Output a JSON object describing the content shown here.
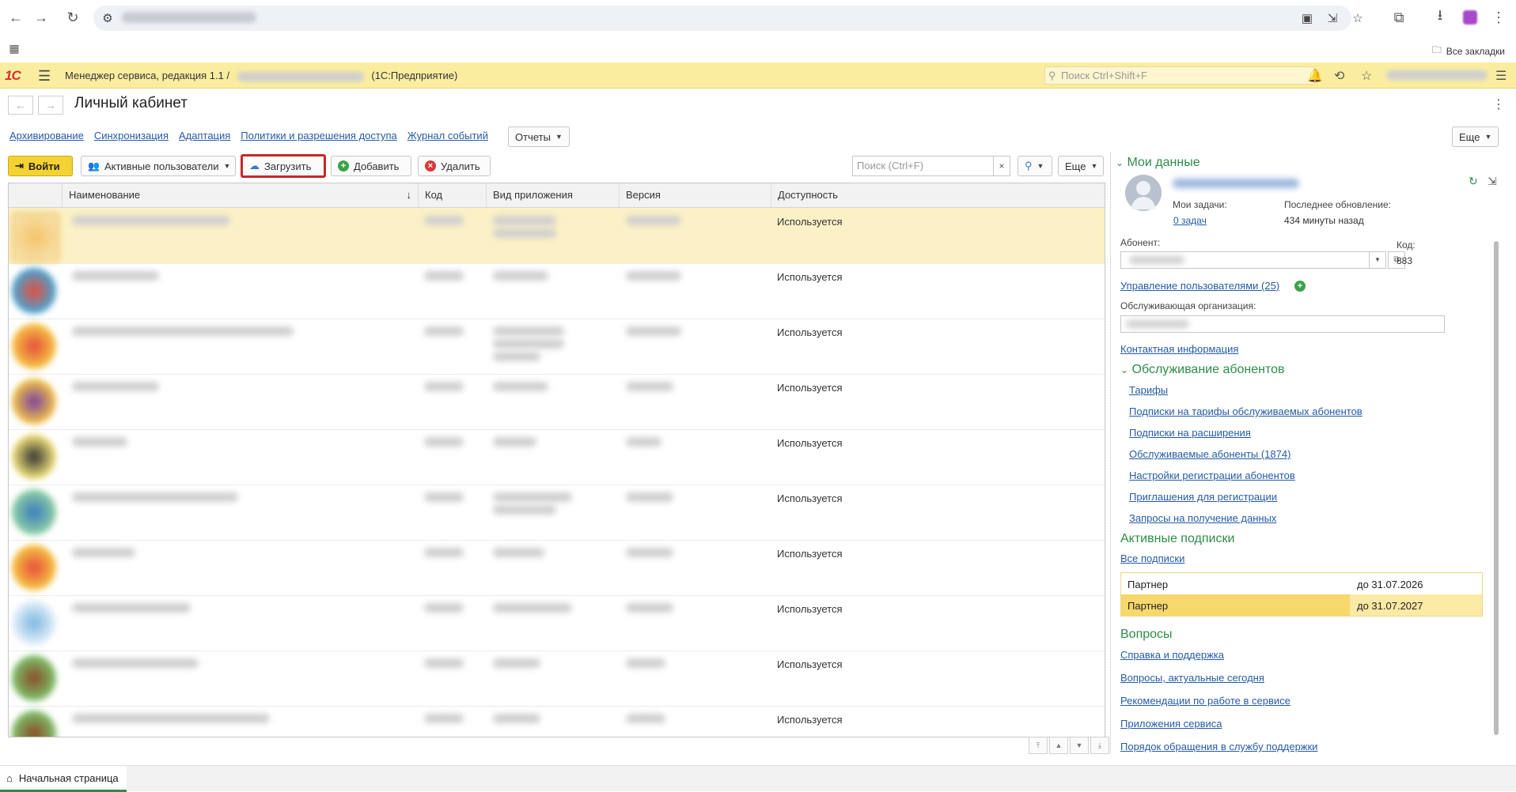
{
  "browser": {
    "bookmarks_all": "Все закладки"
  },
  "app": {
    "title": "Менеджер сервиса, редакция 1.1 /",
    "platform": "(1С:Предприятие)",
    "search_placeholder": "Поиск Ctrl+Shift+F"
  },
  "page": {
    "title": "Личный кабинет"
  },
  "links": [
    "Архивирование",
    "Синхронизация",
    "Адаптация",
    "Политики и разрешения доступа",
    "Журнал событий"
  ],
  "toolbar": {
    "reports": "Отчеты",
    "login": "Войти",
    "active_users": "Активные пользователи",
    "upload": "Загрузить",
    "add": "Добавить",
    "delete": "Удалить",
    "search_placeholder": "Поиск (Ctrl+F)",
    "more": "Еще",
    "more_top": "Еще"
  },
  "table": {
    "columns": [
      "Наименование",
      "Код",
      "Вид приложения",
      "Версия",
      "Доступность"
    ],
    "rows": [
      {
        "availability": "Используется"
      },
      {
        "availability": "Используется"
      },
      {
        "availability": "Используется"
      },
      {
        "availability": "Используется"
      },
      {
        "availability": "Используется"
      },
      {
        "availability": "Используется"
      },
      {
        "availability": "Используется"
      },
      {
        "availability": "Используется"
      },
      {
        "availability": "Используется"
      },
      {
        "availability": "Используется"
      }
    ]
  },
  "right_panel": {
    "my_data_title": "Мои данные",
    "my_tasks_label": "Мои задачи:",
    "my_tasks_link": "0 задач",
    "last_update_label": "Последнее обновление:",
    "last_update_value": "434 минуты назад",
    "subscriber_label": "Абонент:",
    "code_label": "Код:",
    "code_value": "883",
    "manage_users": "Управление пользователями (25)",
    "service_org_label": "Обслуживающая организация:",
    "contact_info": "Контактная информация",
    "service_title": "Обслуживание абонентов",
    "service_links": [
      "Тарифы",
      "Подписки на тарифы обслуживаемых абонентов",
      "Подписки на расширения",
      "Обслуживаемые абоненты (1874)",
      "Настройки регистрации абонентов",
      "Приглашения для регистрации",
      "Запросы на получение данных"
    ],
    "active_subs_title": "Активные подписки",
    "all_subs": "Все подписки",
    "subscriptions": [
      {
        "name": "Партнер",
        "date": "до 31.07.2026"
      },
      {
        "name": "Партнер",
        "date": "до 31.07.2027"
      }
    ],
    "questions_title": "Вопросы",
    "question_links": [
      "Справка и поддержка",
      "Вопросы, актуальные сегодня",
      "Рекомендации по работе в сервисе",
      "Приложения сервиса",
      "Порядок обращения в службу поддержки"
    ]
  },
  "bottom": {
    "home_tab": "Начальная страница"
  },
  "colors": {
    "accent_green": "#2e8c4a",
    "topbar_yellow": "#fbeda0",
    "link_blue": "#255ba6",
    "highlight_red": "#c62828"
  }
}
